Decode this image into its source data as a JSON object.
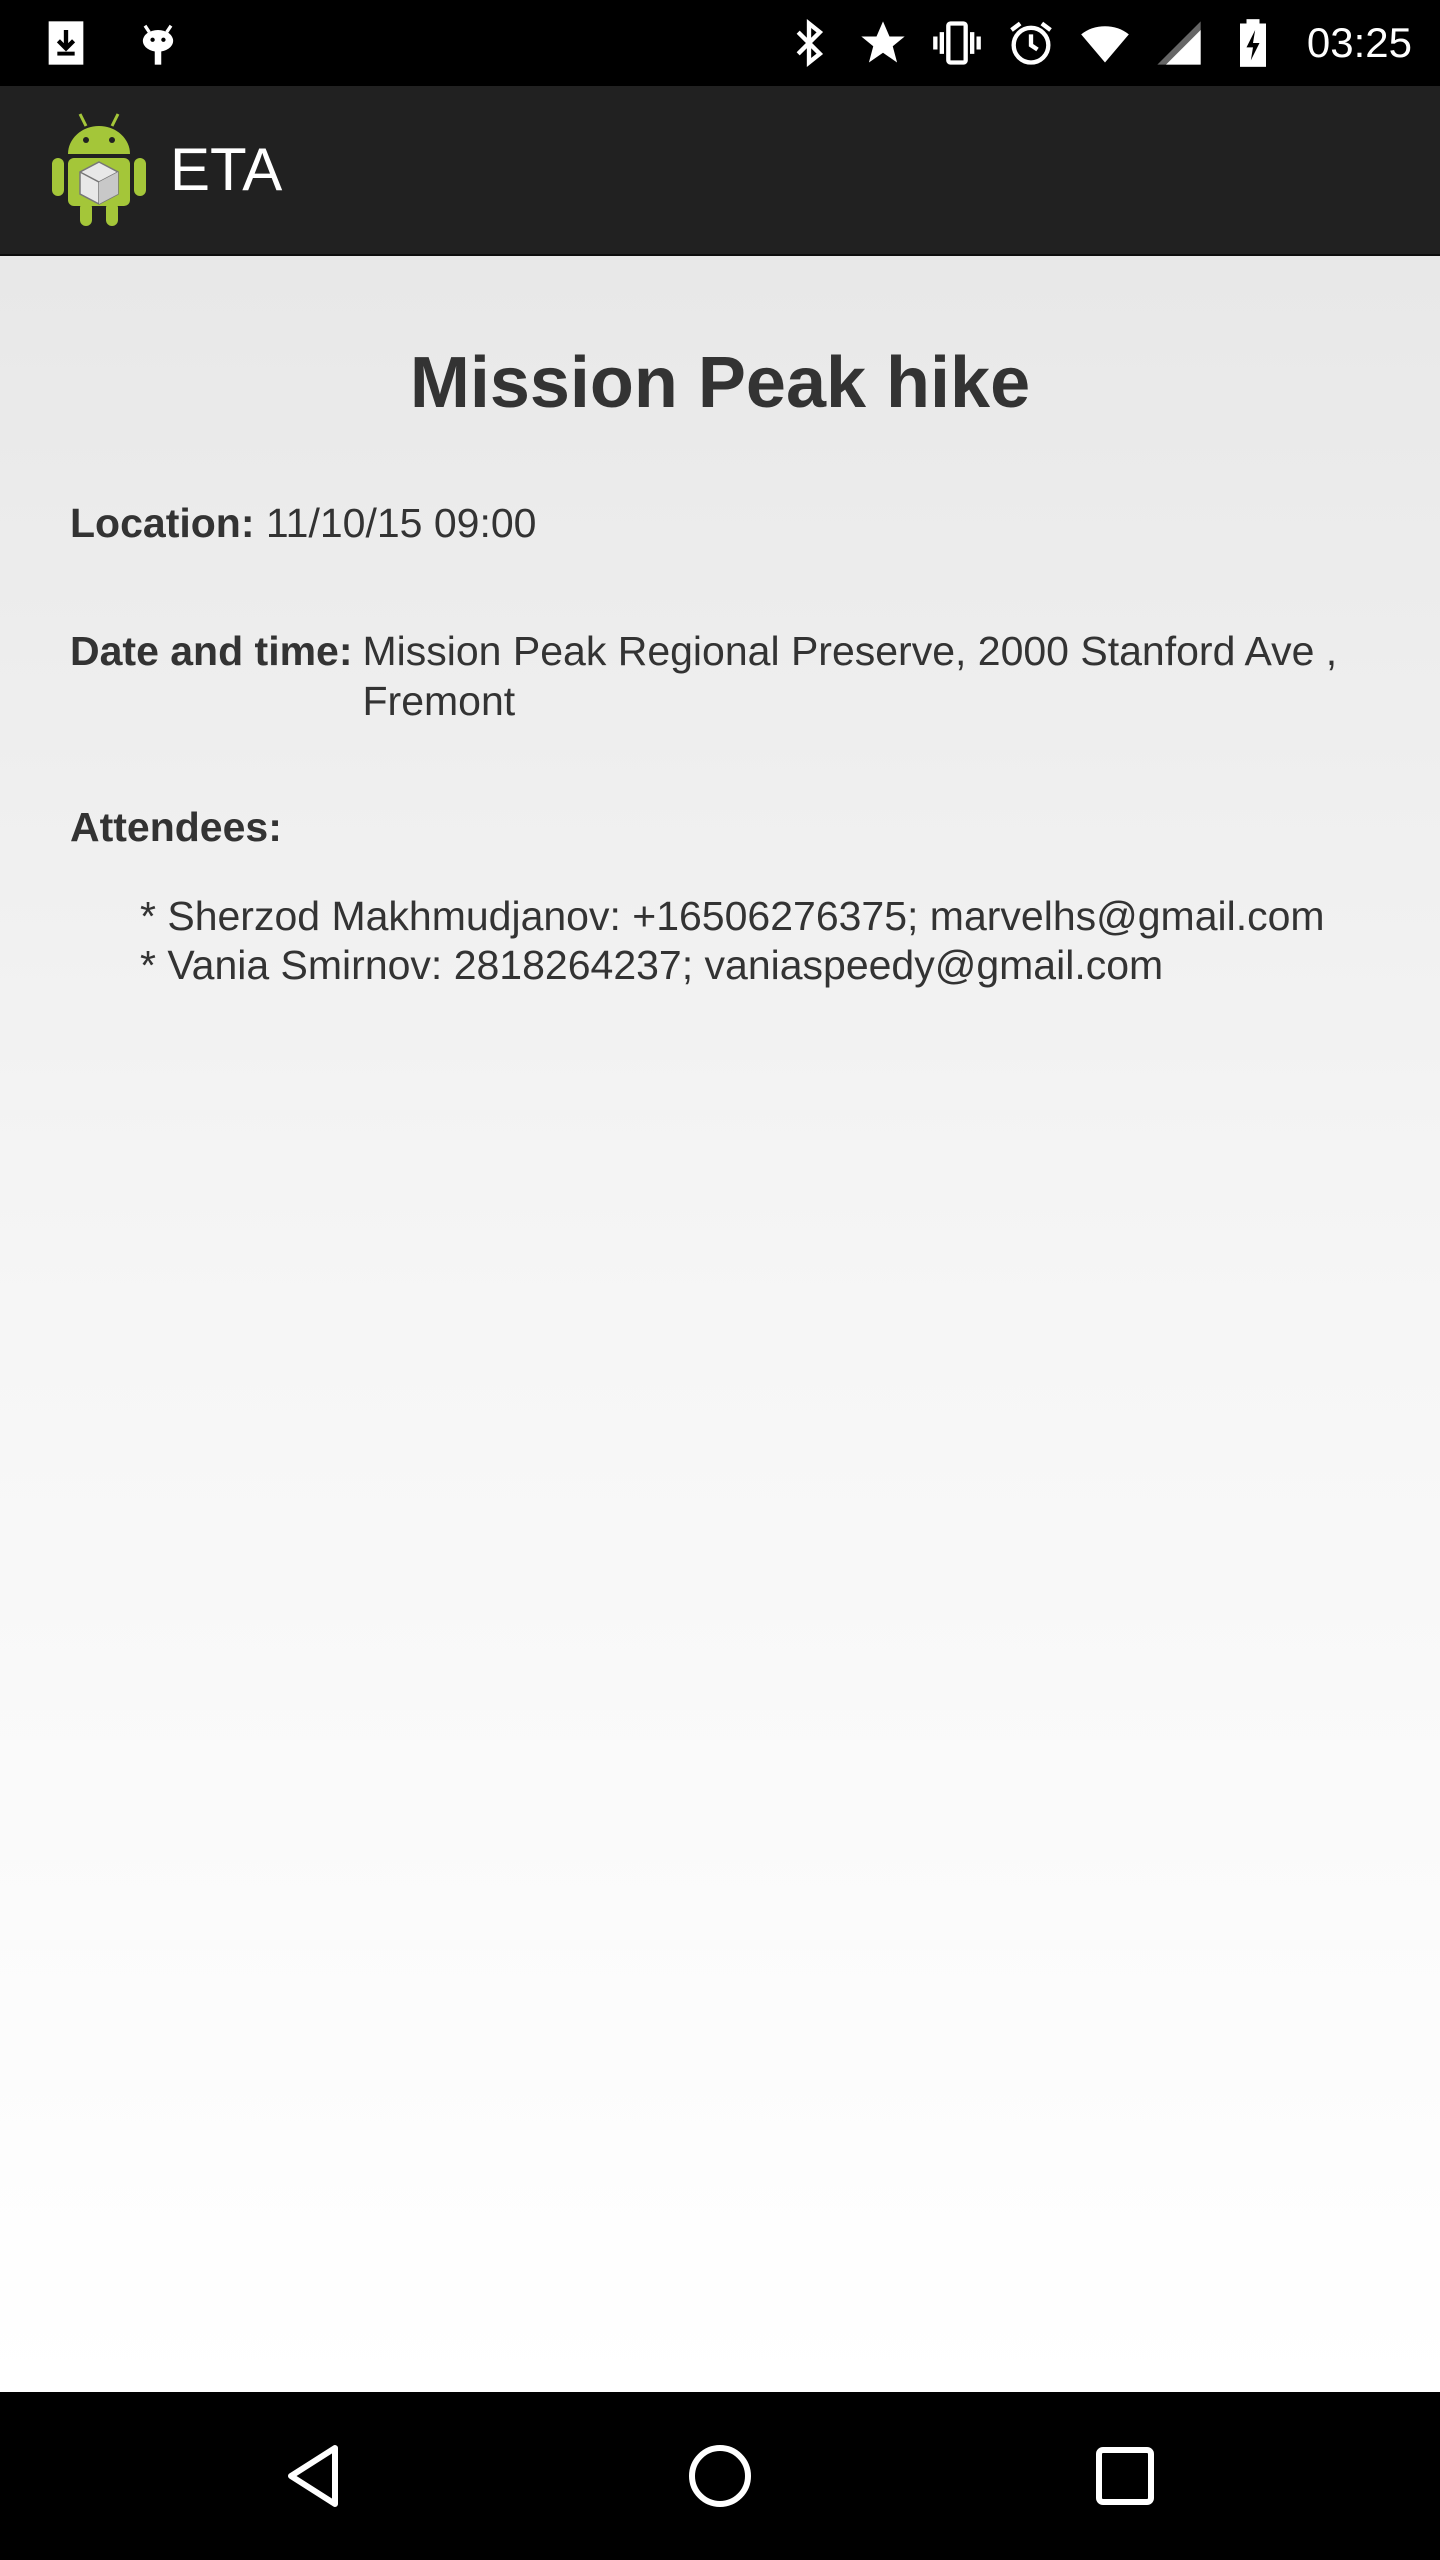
{
  "status_bar": {
    "time": "03:25",
    "left_icons": [
      "download-icon",
      "android-debug-icon"
    ],
    "right_icons": [
      "bluetooth-icon",
      "star-icon",
      "vibrate-icon",
      "alarm-icon",
      "wifi-icon",
      "signal-icon",
      "battery-charging-icon"
    ]
  },
  "action_bar": {
    "app_name": "ETA",
    "icon": "android-app-icon"
  },
  "event": {
    "title": "Mission Peak hike",
    "location_label": "Location:",
    "location_value": "11/10/15 09:00",
    "date_label": "Date and time:",
    "date_value": "Mission Peak Regional Preserve, 2000 Stanford Ave , Fremont",
    "attendees_label": "Attendees:",
    "attendees": [
      "* Sherzod Makhmudjanov: +16506276375; marvelhs@gmail.com",
      "* Vania Smirnov: 2818264237; vaniaspeedy@gmail.com"
    ]
  },
  "nav_bar": {
    "buttons": [
      "back-icon",
      "home-icon",
      "recents-icon"
    ]
  },
  "colors": {
    "status_bar": "#000000",
    "action_bar": "#212121",
    "text": "#333333",
    "android_green": "#a4c639"
  }
}
